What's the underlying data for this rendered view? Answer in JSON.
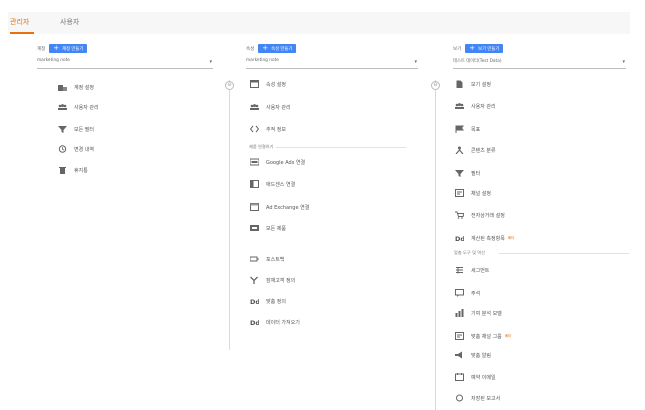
{
  "tabs": [
    {
      "label": "관리자",
      "active": true
    },
    {
      "label": "사용자",
      "active": false
    }
  ],
  "account": {
    "header": "계정",
    "create": "계정 만들기",
    "selected": "marketing note",
    "items": [
      {
        "icon": "building-icon",
        "label": "계정 설정"
      },
      {
        "icon": "users-icon",
        "label": "사용자 관리"
      },
      {
        "icon": "filter-icon",
        "label": "모든 필터"
      },
      {
        "icon": "history-icon",
        "label": "변경 내역"
      },
      {
        "icon": "trash-icon",
        "label": "휴지통"
      }
    ]
  },
  "property": {
    "header": "속성",
    "create": "속성 만들기",
    "selected": "marketing note",
    "items": [
      {
        "icon": "window-icon",
        "label": "속성 설정"
      },
      {
        "icon": "users-icon",
        "label": "사용자 관리"
      },
      {
        "icon": "code-icon",
        "label": "추적 정보"
      }
    ],
    "section": "제품 연결하기",
    "links": [
      {
        "icon": "google-ads-icon",
        "label": "Google Ads 연결"
      },
      {
        "icon": "adsense-icon",
        "label": "애드센스 연결"
      },
      {
        "icon": "ad-exchange-icon",
        "label": "Ad Exchange 연결"
      },
      {
        "icon": "all-products-icon",
        "label": "모든 제품"
      }
    ],
    "more": [
      {
        "icon": "postback-icon",
        "label": "포스트백"
      },
      {
        "icon": "audience-icon",
        "label": "잠재고객 정의"
      },
      {
        "icon": "dd-icon",
        "label": "맞춤 정의"
      },
      {
        "icon": "dd-icon",
        "label": "데이터 가져오기"
      }
    ]
  },
  "view": {
    "header": "보기",
    "create": "보기 만들기",
    "selected": "테스트 데이터(Test Data)",
    "items": [
      {
        "icon": "document-icon",
        "label": "보기 설정"
      },
      {
        "icon": "users-icon",
        "label": "사용자 관리"
      },
      {
        "icon": "flag-icon",
        "label": "목표"
      },
      {
        "icon": "content-group-icon",
        "label": "콘텐츠 분류"
      },
      {
        "icon": "filter-icon",
        "label": "필터"
      },
      {
        "icon": "channel-icon",
        "label": "채널 설정"
      },
      {
        "icon": "cart-icon",
        "label": "전자상거래 설정"
      },
      {
        "icon": "dd-icon",
        "label": "계산된 측정항목",
        "badge": "베타"
      }
    ],
    "section": "맞춤 도구 및 역산",
    "tools": [
      {
        "icon": "segment-icon",
        "label": "세그먼트"
      },
      {
        "icon": "annotation-icon",
        "label": "주석"
      },
      {
        "icon": "attribution-icon",
        "label": "기여 분석 모델"
      },
      {
        "icon": "channel-icon",
        "label": "맞춤 채널 그룹",
        "badge": "베타"
      },
      {
        "icon": "alert-icon",
        "label": "맞춤 알림"
      },
      {
        "icon": "email-icon",
        "label": "예약 이메일"
      },
      {
        "icon": "report-icon",
        "label": "저장된 보고서"
      }
    ]
  }
}
